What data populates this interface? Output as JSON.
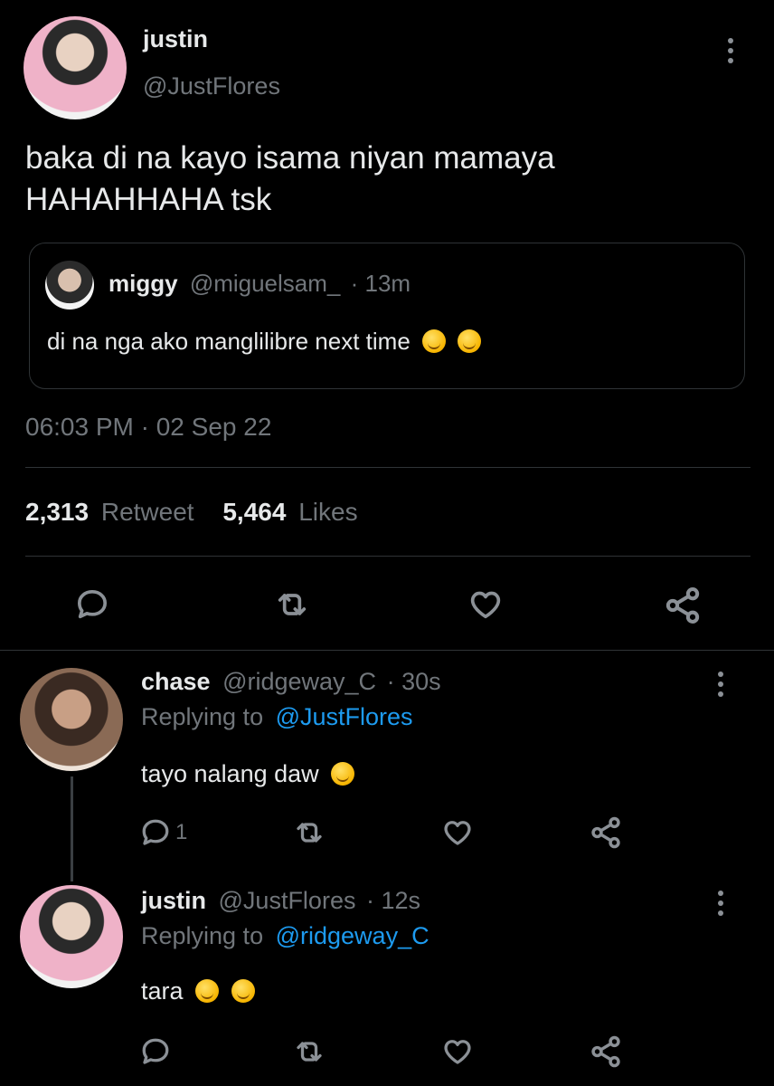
{
  "tweet": {
    "author_name": "justin",
    "author_handle": "@JustFlores",
    "text_line1": "baka di na kayo isama niyan mamaya",
    "text_line2": "HAHAHHAHA tsk",
    "quoted": {
      "author_name": "miggy",
      "author_handle": "@miguelsam_",
      "time": "· 13m",
      "text": "di na nga ako manglilibre next time"
    },
    "timestamp": "06:03 PM · 02 Sep 22",
    "retweet_count": "2,313",
    "retweet_label": "Retweet",
    "likes_count": "5,464",
    "likes_label": "Likes"
  },
  "replies": [
    {
      "author_name": "chase",
      "author_handle": "@ridgeway_C",
      "time": "· 30s",
      "replying_prefix": "Replying to",
      "replying_to": "@JustFlores",
      "text": "tayo nalang daw",
      "reply_count": "1"
    },
    {
      "author_name": "justin",
      "author_handle": "@JustFlores",
      "time": "· 12s",
      "replying_prefix": "Replying to",
      "replying_to": "@ridgeway_C",
      "text": "tara",
      "reply_count": ""
    }
  ],
  "icons": {
    "reply": "speech-bubble-icon",
    "retweet": "retweet-arrows-icon",
    "like": "heart-icon",
    "share": "share-nodes-icon",
    "more": "vertical-dots-icon"
  },
  "colors": {
    "background": "#000000",
    "text": "#e7e9ea",
    "muted": "#71767b",
    "link": "#1d9bf0",
    "divider": "#2f3336"
  }
}
